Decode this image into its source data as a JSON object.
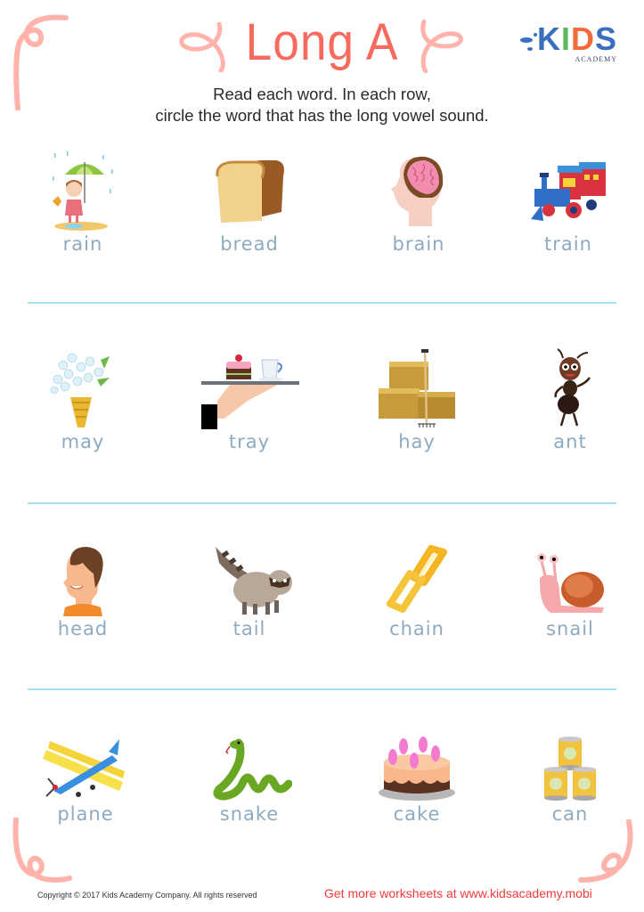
{
  "header": {
    "title": "Long A",
    "instructions_line1": "Read each word. In each row,",
    "instructions_line2": "circle the word that has the long vowel sound.",
    "logo": {
      "main": "KIDS",
      "sub": "ACADEMY",
      "colors": {
        "K": "#3a6fbf",
        "I": "#5cb85c",
        "D": "#f26b3a",
        "S": "#3a6fbf"
      }
    }
  },
  "colors": {
    "title": "#f76b5f",
    "swirl": "#ffb3ab",
    "word": "#8eaac0",
    "divider": "#a6e0ee",
    "promo": "#f23a3a"
  },
  "rows": [
    {
      "items": [
        {
          "word": "rain",
          "icon": "girl-umbrella-rain-icon"
        },
        {
          "word": "bread",
          "icon": "bread-loaf-icon"
        },
        {
          "word": "brain",
          "icon": "head-brain-icon"
        },
        {
          "word": "train",
          "icon": "toy-train-icon"
        }
      ]
    },
    {
      "items": [
        {
          "word": "may",
          "icon": "flower-vase-icon"
        },
        {
          "word": "tray",
          "icon": "serving-tray-icon"
        },
        {
          "word": "hay",
          "icon": "hay-bales-icon"
        },
        {
          "word": "ant",
          "icon": "ant-icon"
        }
      ]
    },
    {
      "items": [
        {
          "word": "head",
          "icon": "man-head-icon"
        },
        {
          "word": "tail",
          "icon": "raccoon-tail-icon"
        },
        {
          "word": "chain",
          "icon": "chain-link-icon"
        },
        {
          "word": "snail",
          "icon": "snail-icon"
        }
      ]
    },
    {
      "items": [
        {
          "word": "plane",
          "icon": "biplane-icon"
        },
        {
          "word": "snake",
          "icon": "snake-icon"
        },
        {
          "word": "cake",
          "icon": "cake-icon"
        },
        {
          "word": "can",
          "icon": "stacked-cans-icon"
        }
      ]
    }
  ],
  "footer": {
    "copyright": "Copyright © 2017 Kids Academy Company. All rights reserved",
    "promo": "Get more worksheets at www.kidsacademy.mobi"
  }
}
